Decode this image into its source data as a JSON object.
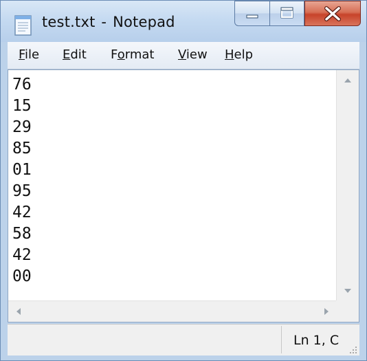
{
  "window": {
    "title_file": "test.txt",
    "title_sep": "-",
    "title_app": "Notepad"
  },
  "menu": {
    "file": {
      "accel": "F",
      "rest": "ile"
    },
    "edit": {
      "accel": "E",
      "rest": "dit"
    },
    "format": {
      "pre": "F",
      "accel": "o",
      "rest": "rmat"
    },
    "view": {
      "accel": "V",
      "rest": "iew"
    },
    "help": {
      "accel": "H",
      "rest": "elp"
    }
  },
  "editor": {
    "lines": [
      "76",
      "15",
      "29",
      "85",
      "01",
      "95",
      "42",
      "58",
      "42",
      "00"
    ]
  },
  "status": {
    "position": "Ln 1, C"
  },
  "icons": {
    "app": "notepad-icon",
    "minimize": "minimize-icon",
    "maximize": "maximize-icon",
    "close": "close-icon"
  },
  "colors": {
    "title_gradient_top": "#d9e7f6",
    "close_button": "#c7432a",
    "chrome_border": "#6b8cb5"
  }
}
